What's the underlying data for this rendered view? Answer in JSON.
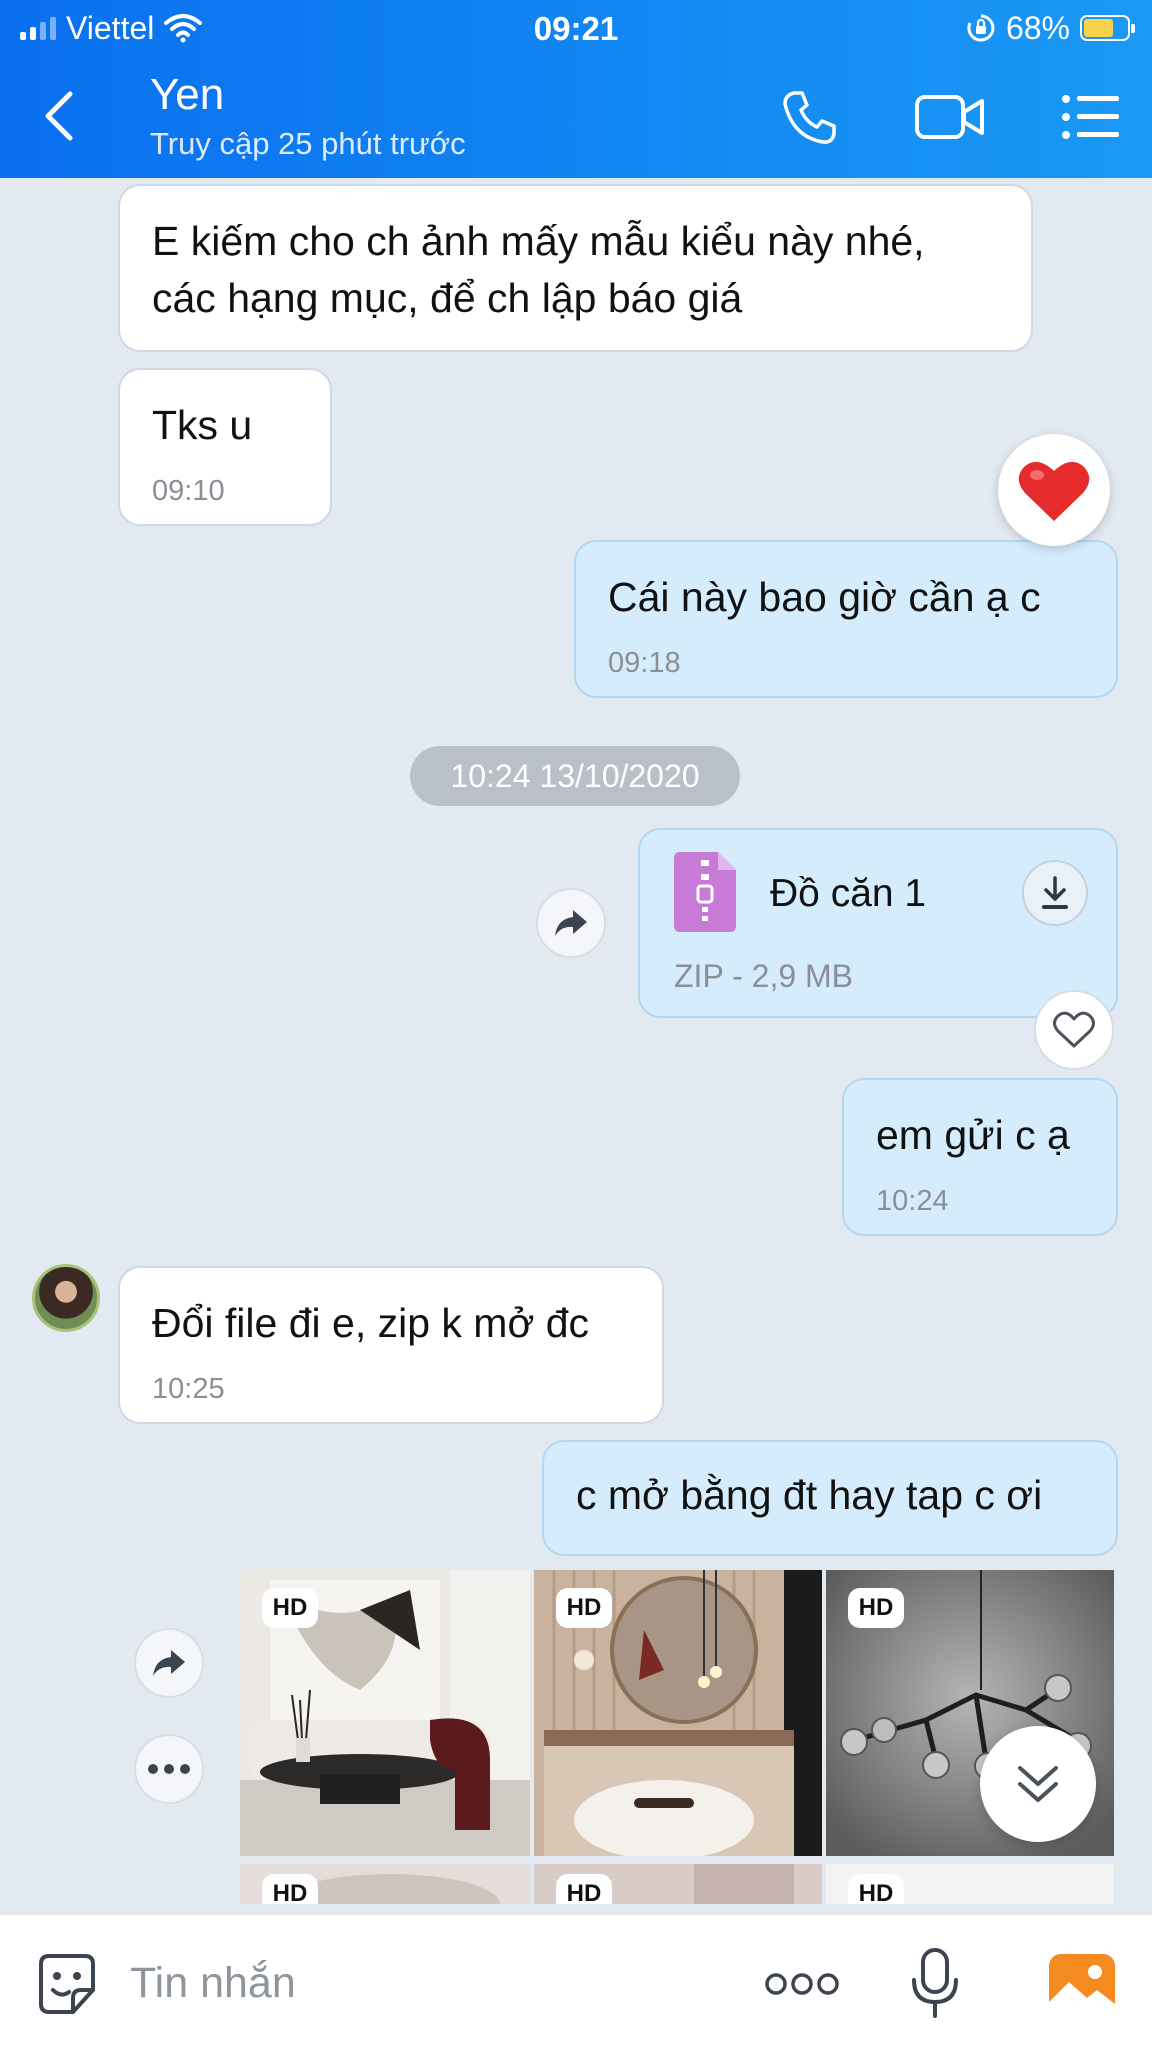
{
  "status_bar": {
    "carrier": "Viettel",
    "time": "09:21",
    "battery": "68%"
  },
  "header": {
    "title": "Yen",
    "subtitle": "Truy cập 25 phút trước",
    "icons": [
      "back-icon",
      "phone-icon",
      "video-call-icon",
      "menu-list-icon"
    ]
  },
  "messages": {
    "m1": {
      "text_line1": "E kiếm cho ch ảnh mấy mẫu kiểu này nhé,",
      "text_line2": "các hạng mục, để ch lập báo giá"
    },
    "m2": {
      "text": "Tks u",
      "time": "09:10"
    },
    "m3": {
      "text": "Cái này bao giờ cần ạ c",
      "time": "09:18",
      "reaction": "heart"
    },
    "date_separator": "10:24 13/10/2020",
    "m4_file": {
      "name": "Đồ căn 1",
      "meta": "ZIP - 2,9 MB"
    },
    "m5": {
      "text": "em gửi c ạ",
      "time": "10:24"
    },
    "m6": {
      "text": "Đổi file đi e, zip k mở đc",
      "time": "10:25"
    },
    "m7": {
      "text": "c mở bằng đt hay tap c ơi"
    },
    "photos": {
      "badge": "HD"
    }
  },
  "input_bar": {
    "placeholder": "Tin nhắn",
    "more_label": "ooo"
  },
  "colors": {
    "header_blue": "#0a6ff0",
    "outgoing_bubble": "#d5ecfd",
    "incoming_bubble": "#ffffff",
    "background": "#e2e9f1",
    "heart_red": "#e52b2b"
  }
}
